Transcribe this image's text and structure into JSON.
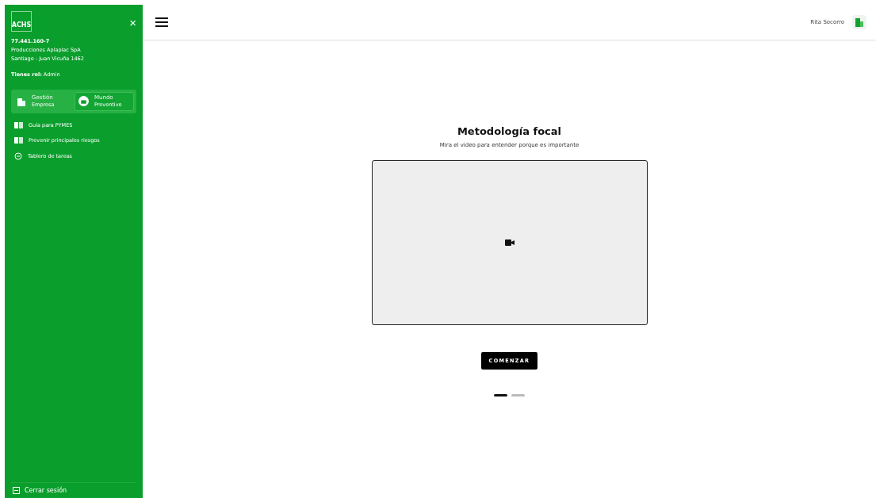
{
  "sidebar": {
    "logo": "ACHS",
    "close": "×",
    "company_id": "77.441.160-7",
    "company_name": "Producciones Aplaplac SpA",
    "address": "Santiago - Juan Vicuña 1462",
    "role_label": "Tienes rol:",
    "role": "Admin",
    "switch": [
      {
        "caption": "Gestión",
        "label": "Empresa",
        "selected": false
      },
      {
        "caption": "Mundo",
        "label": "Preventivo",
        "selected": true
      }
    ],
    "items": [
      {
        "label": "Guía para PYMES",
        "kind": "book"
      },
      {
        "label": "Prevenir principales riesgos",
        "kind": "book"
      },
      {
        "label": "Tablero de tareas",
        "kind": "clock"
      }
    ],
    "logout": "Cerrar sesión"
  },
  "header": {
    "user": "Rita Socorro"
  },
  "main": {
    "title": "Metodología focal",
    "subtitle": "Mira el video para entender porque es importante",
    "button": "COMENZAR",
    "pages": [
      {
        "selected": true
      },
      {
        "selected": false
      }
    ]
  }
}
